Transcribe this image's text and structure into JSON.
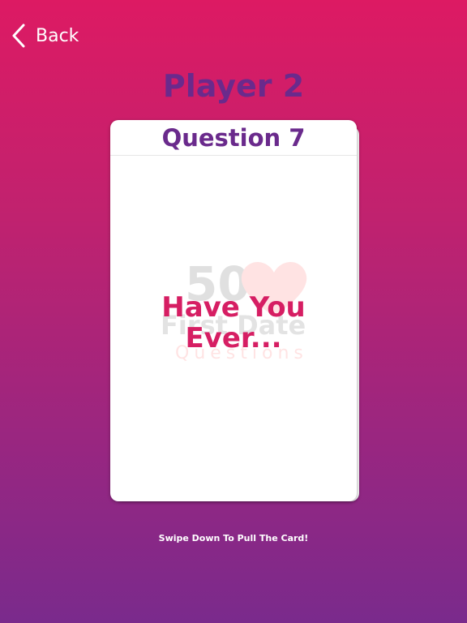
{
  "nav": {
    "back_label": "Back"
  },
  "header": {
    "player_title": "Player 2"
  },
  "card": {
    "question_label": "Question 7",
    "question_line1": "Have You",
    "question_line2": "Ever...",
    "watermark": {
      "number": "50",
      "line1": "First Date",
      "line2": "Questions"
    }
  },
  "footer": {
    "hint": "Swipe Down To Pull The Card!"
  },
  "colors": {
    "gradient_top": "#dd1a63",
    "gradient_bottom": "#7a2a8c",
    "title_purple": "#6a2a8c",
    "question_pink": "#d61e63",
    "card_white": "#ffffff"
  },
  "icons": {
    "back": "chevron-left-icon",
    "watermark_heart": "heart-icon"
  }
}
